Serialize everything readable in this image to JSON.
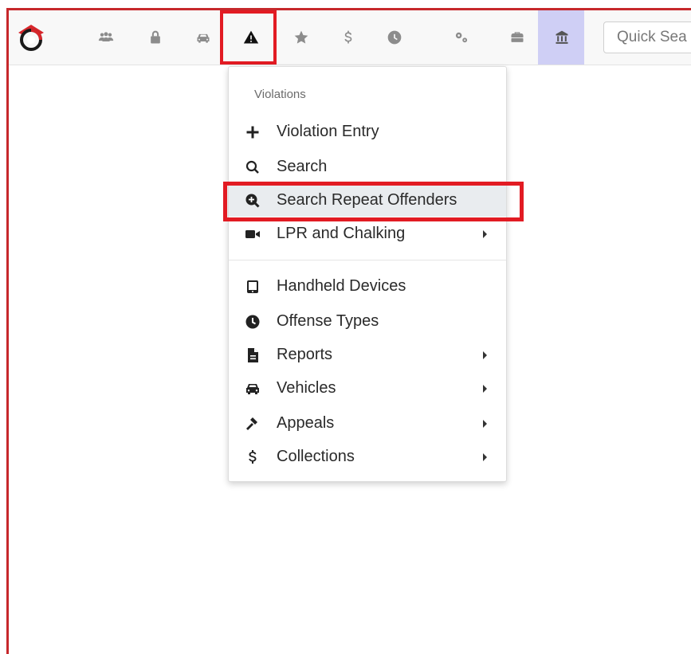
{
  "navbar": {
    "icons": [
      "users-icon",
      "lock-icon",
      "car-icon",
      "warning-icon",
      "star-icon",
      "dollar-icon",
      "clock-icon",
      "cogs-icon",
      "toolbox-icon",
      "building-icon"
    ],
    "quick_search_placeholder": "Quick Sea"
  },
  "dropdown": {
    "header": "Violations",
    "items": [
      {
        "label": "Violation Entry",
        "icon": "plus-icon",
        "submenu": false
      },
      {
        "label": "Search",
        "icon": "search-icon",
        "submenu": false
      },
      {
        "label": "Search Repeat Offenders",
        "icon": "search-plus-icon",
        "submenu": false
      },
      {
        "label": "LPR and Chalking",
        "icon": "video-camera-icon",
        "submenu": true
      },
      {
        "label": "Handheld Devices",
        "icon": "tablet-icon",
        "submenu": false
      },
      {
        "label": "Offense Types",
        "icon": "clock-icon",
        "submenu": false
      },
      {
        "label": "Reports",
        "icon": "file-icon",
        "submenu": true
      },
      {
        "label": "Vehicles",
        "icon": "car-icon",
        "submenu": true
      },
      {
        "label": "Appeals",
        "icon": "gavel-icon",
        "submenu": true
      },
      {
        "label": "Collections",
        "icon": "dollar-icon",
        "submenu": true
      }
    ]
  },
  "colors": {
    "highlight": "#e21b23",
    "active_nav_bg": "#cfcff5",
    "frame": "#c6282b"
  }
}
